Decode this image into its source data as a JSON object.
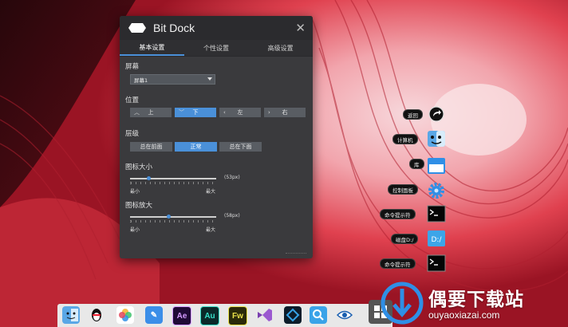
{
  "panel": {
    "title": "Bit Dock",
    "tabs": [
      "基本设置",
      "个性设置",
      "高级设置"
    ],
    "screen": {
      "label": "屏幕",
      "selected": "屏幕1"
    },
    "position": {
      "label": "位置",
      "options": [
        "上",
        "下",
        "左",
        "右"
      ],
      "selected": "下"
    },
    "layer": {
      "label": "层级",
      "options": [
        "总在前面",
        "正常",
        "总在下面"
      ],
      "selected": "正常"
    },
    "icon_size": {
      "label": "图标大小",
      "value_text": "(53px)",
      "min_label": "最小",
      "max_label": "最大",
      "level": 0.22
    },
    "icon_zoom": {
      "label": "图标放大",
      "value_text": "(58px)",
      "min_label": "最小",
      "max_label": "最大",
      "level": 0.45
    }
  },
  "side_items": [
    {
      "label": "返回",
      "icon": "return-icon"
    },
    {
      "label": "计算机",
      "icon": "finder-face-icon"
    },
    {
      "label": "库",
      "icon": "library-icon"
    },
    {
      "label": "控制面板",
      "icon": "gear-icon"
    },
    {
      "label": "命令提示符",
      "icon": "terminal-icon"
    },
    {
      "label": "磁盘D:/",
      "icon": "disk-icon"
    },
    {
      "label": "命令提示符",
      "icon": "terminal-icon"
    }
  ],
  "dock_icons": [
    {
      "name": "finder-icon",
      "text": ""
    },
    {
      "name": "qq-penguin-icon",
      "text": ""
    },
    {
      "name": "photos-icon",
      "text": ""
    },
    {
      "name": "notes-icon",
      "text": ""
    },
    {
      "name": "after-effects-icon",
      "text": "Ae"
    },
    {
      "name": "audition-icon",
      "text": "Au"
    },
    {
      "name": "fireworks-icon",
      "text": "Fw"
    },
    {
      "name": "visual-studio-icon",
      "text": ""
    },
    {
      "name": "dreamweaver-icon",
      "text": ""
    },
    {
      "name": "search-icon",
      "text": ""
    },
    {
      "name": "eye-icon",
      "text": ""
    },
    {
      "name": "windows-icon",
      "text": ""
    }
  ],
  "watermark": {
    "main": "偶要下载站",
    "sub": "ouyaoxiazai.com"
  },
  "colors": {
    "accent": "#4a90d9",
    "panel_bg": "#3a3a3d",
    "wallpaper_red": "#e8485a"
  }
}
